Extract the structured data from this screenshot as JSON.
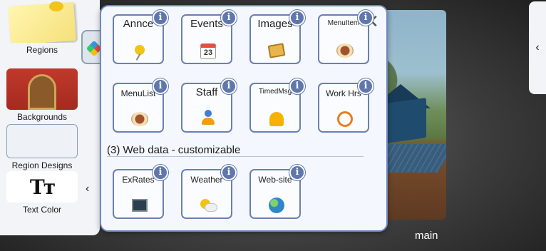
{
  "sidebar": {
    "items": [
      {
        "label": "Regions",
        "icon": "sticky-note-icon"
      },
      {
        "label": "Backgrounds",
        "icon": "background-thumbnail-icon"
      },
      {
        "label": "Region Designs",
        "icon": "region-design-icon"
      },
      {
        "label": "Text Color",
        "icon": "text-color-icon"
      }
    ],
    "text_color_glyph": "Tт",
    "collapse_glyph": "‹"
  },
  "right_panel": {
    "expand_glyph": "‹"
  },
  "preview": {
    "label": "main"
  },
  "popup": {
    "close_glyph": "✕",
    "info_glyph": "i",
    "tiles": [
      {
        "label": "Annce",
        "icon": "pushpin-icon"
      },
      {
        "label": "Events",
        "icon": "calendar-icon",
        "icon_text": "23"
      },
      {
        "label": "Images",
        "icon": "images-icon"
      },
      {
        "label": "MenuItem",
        "icon": "food-plate-icon"
      },
      {
        "label": "MenuList",
        "icon": "food-plate-icon"
      },
      {
        "label": "Staff",
        "icon": "person-icon"
      },
      {
        "label": "TimedMsg",
        "icon": "bell-icon"
      },
      {
        "label": "Work Hrs",
        "icon": "alarm-clock-icon"
      }
    ],
    "section_title": "(3) Web data - customizable",
    "web_tiles": [
      {
        "label": "ExRates",
        "icon": "presentation-board-icon"
      },
      {
        "label": "Weather",
        "icon": "sun-cloud-icon"
      },
      {
        "label": "Web-site",
        "icon": "globe-icon"
      }
    ]
  },
  "colors": {
    "popup_border": "#6f88c0",
    "info_badge": "#5f77ab",
    "panel_bg": "#f2f4f7"
  }
}
